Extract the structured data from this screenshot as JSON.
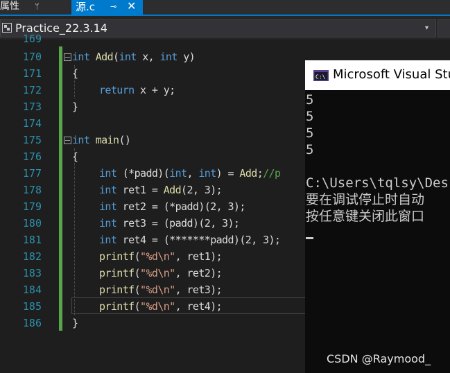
{
  "tabs": {
    "properties_label": "属性",
    "properties_pin": "ᛘ",
    "active_tab": "源.c",
    "pin_glyph": "⊸",
    "close_glyph": "✕"
  },
  "navbar": {
    "project": "Practice_22.3.14",
    "dropdown_arrow": "▾"
  },
  "editor": {
    "partial_top_number": "169",
    "partial_top_code": "//",
    "lines": [
      {
        "n": "170"
      },
      {
        "n": "171"
      },
      {
        "n": "172"
      },
      {
        "n": "173"
      },
      {
        "n": "174"
      },
      {
        "n": "175"
      },
      {
        "n": "176"
      },
      {
        "n": "177"
      },
      {
        "n": "178"
      },
      {
        "n": "179"
      },
      {
        "n": "180"
      },
      {
        "n": "181"
      },
      {
        "n": "182"
      },
      {
        "n": "183"
      },
      {
        "n": "184"
      },
      {
        "n": "185"
      },
      {
        "n": "186"
      }
    ],
    "code": {
      "l170_kw": "int",
      "l170_fn": "Add",
      "l170_rest1": "(",
      "l170_kw2": "int",
      "l170_rest2": " x, ",
      "l170_kw3": "int",
      "l170_rest3": " y)",
      "l171": "{",
      "l172_kw": "return",
      "l172_rest": " x + y;",
      "l173": "}",
      "l175_kw": "int",
      "l175_fn": "main",
      "l175_rest": "()",
      "l176": "{",
      "l177_kw": "int",
      "l177_a": " (*padd)(",
      "l177_kw2": "int",
      "l177_b": ", ",
      "l177_kw3": "int",
      "l177_c": ") = ",
      "l177_fn": "Add",
      "l177_d": ";",
      "l177_cm": "//p",
      "l178_kw": "int",
      "l178_a": " ret1 = ",
      "l178_fn": "Add",
      "l178_b": "(2, 3);",
      "l179_kw": "int",
      "l179_a": " ret2 = (*padd)(2, 3);",
      "l180_kw": "int",
      "l180_a": " ret3 = (padd)(2, 3);",
      "l181_kw": "int",
      "l181_a": " ret4 = (*******padd)(2, 3);",
      "printf": "printf",
      "fmt": "\"%d\\n\"",
      "l182_b": ", ret1);",
      "l183_b": ", ret2);",
      "l184_b": ", ret3);",
      "l185_b": ", ret4);",
      "l186": "}"
    }
  },
  "console": {
    "title": "Microsoft Visual Stu",
    "output": [
      "5",
      "5",
      "5",
      "5"
    ],
    "path_line": "C:\\Users\\tqlsy\\Des",
    "msg1": "要在调试停止时自动",
    "msg2": "按任意键关闭此窗口",
    "watermark": "CSDN @Raymood_"
  },
  "colors": {
    "keyword": "#569cd6",
    "function": "#dcdcaa",
    "string": "#d69d85",
    "comment": "#57a64a",
    "line_number": "#2b91af",
    "accent": "#007acc"
  }
}
